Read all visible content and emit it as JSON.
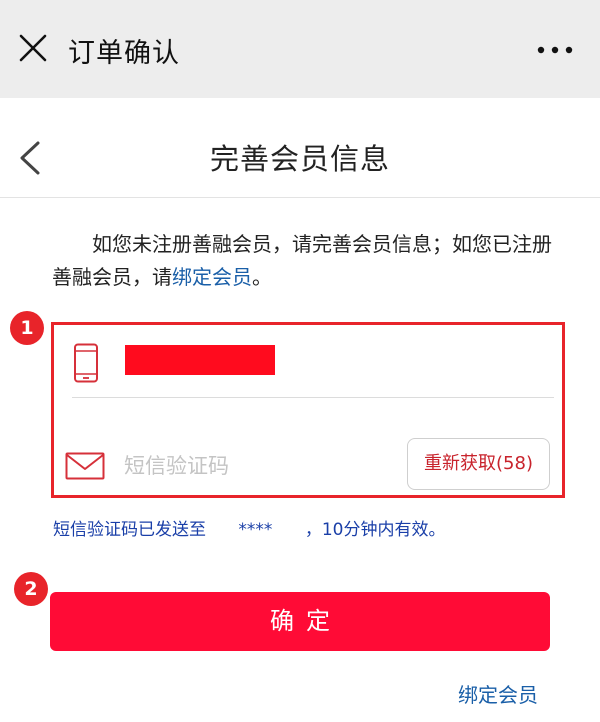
{
  "topbar": {
    "title": "订单确认",
    "close_icon": "close-icon",
    "more_icon": "more-icon"
  },
  "navbar": {
    "title": "完善会员信息",
    "back_icon": "chevron-left-icon"
  },
  "intro": {
    "text": "如您未注册善融会员，请完善会员信息；如您已注册善融会员，请",
    "link": "绑定会员",
    "suffix": "。"
  },
  "markers": {
    "first": "1",
    "second": "2"
  },
  "form": {
    "phone_icon": "phone-icon",
    "sms_icon": "mail-icon",
    "code_placeholder": "短信验证码",
    "resend_label": "重新获取(58)"
  },
  "sent_note": "短信验证码已发送至      ****      ，10分钟内有效。",
  "confirm_label": "确定",
  "bind_link": "绑定会员",
  "colors": {
    "accent": "#ff0b36",
    "highlight_border": "#e8242a",
    "link": "#1a5fa8",
    "note": "#1a3fa8"
  }
}
